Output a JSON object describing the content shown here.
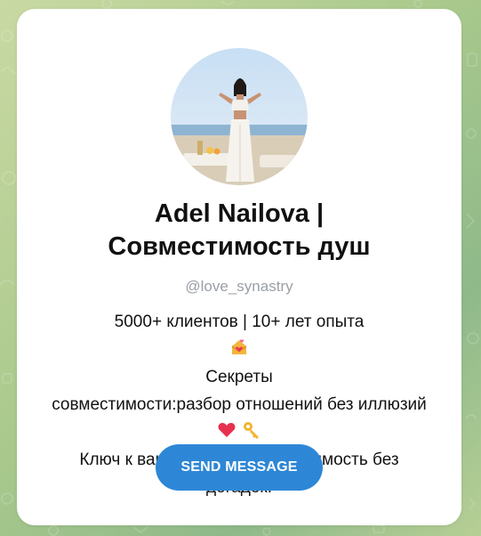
{
  "profile": {
    "title_line1": "Adel Nailova |",
    "title_line2": "Совместимость душ",
    "username": "@love_synastry",
    "avatar_icon": "profile-photo",
    "description": {
      "line1_text": "5000+ клиентов | 10+ лет опыта",
      "line1_emoji": "love-letter-icon",
      "line1_tail": "Секреты",
      "line2": "совместимости:разбор отношений без иллюзий",
      "line3_emojis": [
        "heart-icon",
        "key-icon"
      ],
      "line3_text": "Ключ к вашей паре – совместимость без",
      "line4": "догадок!"
    }
  },
  "actions": {
    "send_message_label": "SEND MESSAGE"
  },
  "colors": {
    "button": "#2d87d6",
    "card": "#ffffff",
    "username": "#9aa0a6",
    "background": "#a9c98c"
  }
}
